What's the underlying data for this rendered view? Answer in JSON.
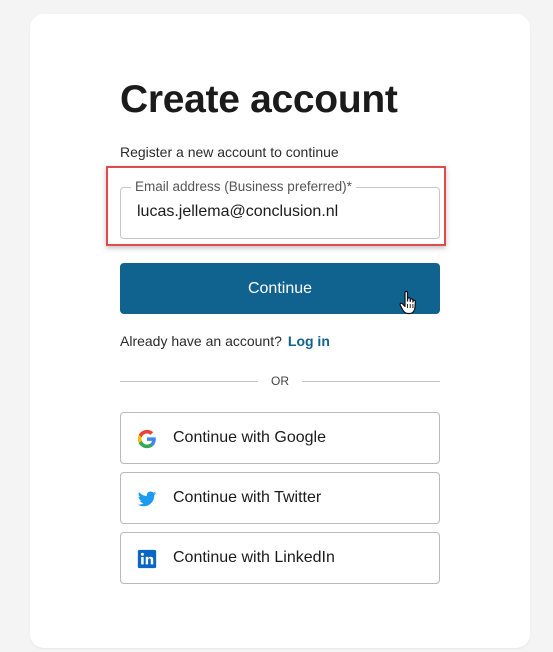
{
  "page": {
    "title": "Create account",
    "subtitle": "Register a new account to continue"
  },
  "email_field": {
    "label": "Email address (Business preferred)*",
    "value": "lucas.jellema@conclusion.nl"
  },
  "continue_button": {
    "label": "Continue"
  },
  "login": {
    "prompt": "Already have an account?",
    "link_label": "Log in"
  },
  "divider": {
    "label": "OR"
  },
  "social": [
    {
      "label": "Continue with Google",
      "icon": "google-icon"
    },
    {
      "label": "Continue with Twitter",
      "icon": "twitter-icon"
    },
    {
      "label": "Continue with LinkedIn",
      "icon": "linkedin-icon"
    }
  ],
  "colors": {
    "primary": "#10628f",
    "highlight": "#e04c4c",
    "twitter": "#1d9bf0",
    "linkedin": "#0a66c2"
  }
}
